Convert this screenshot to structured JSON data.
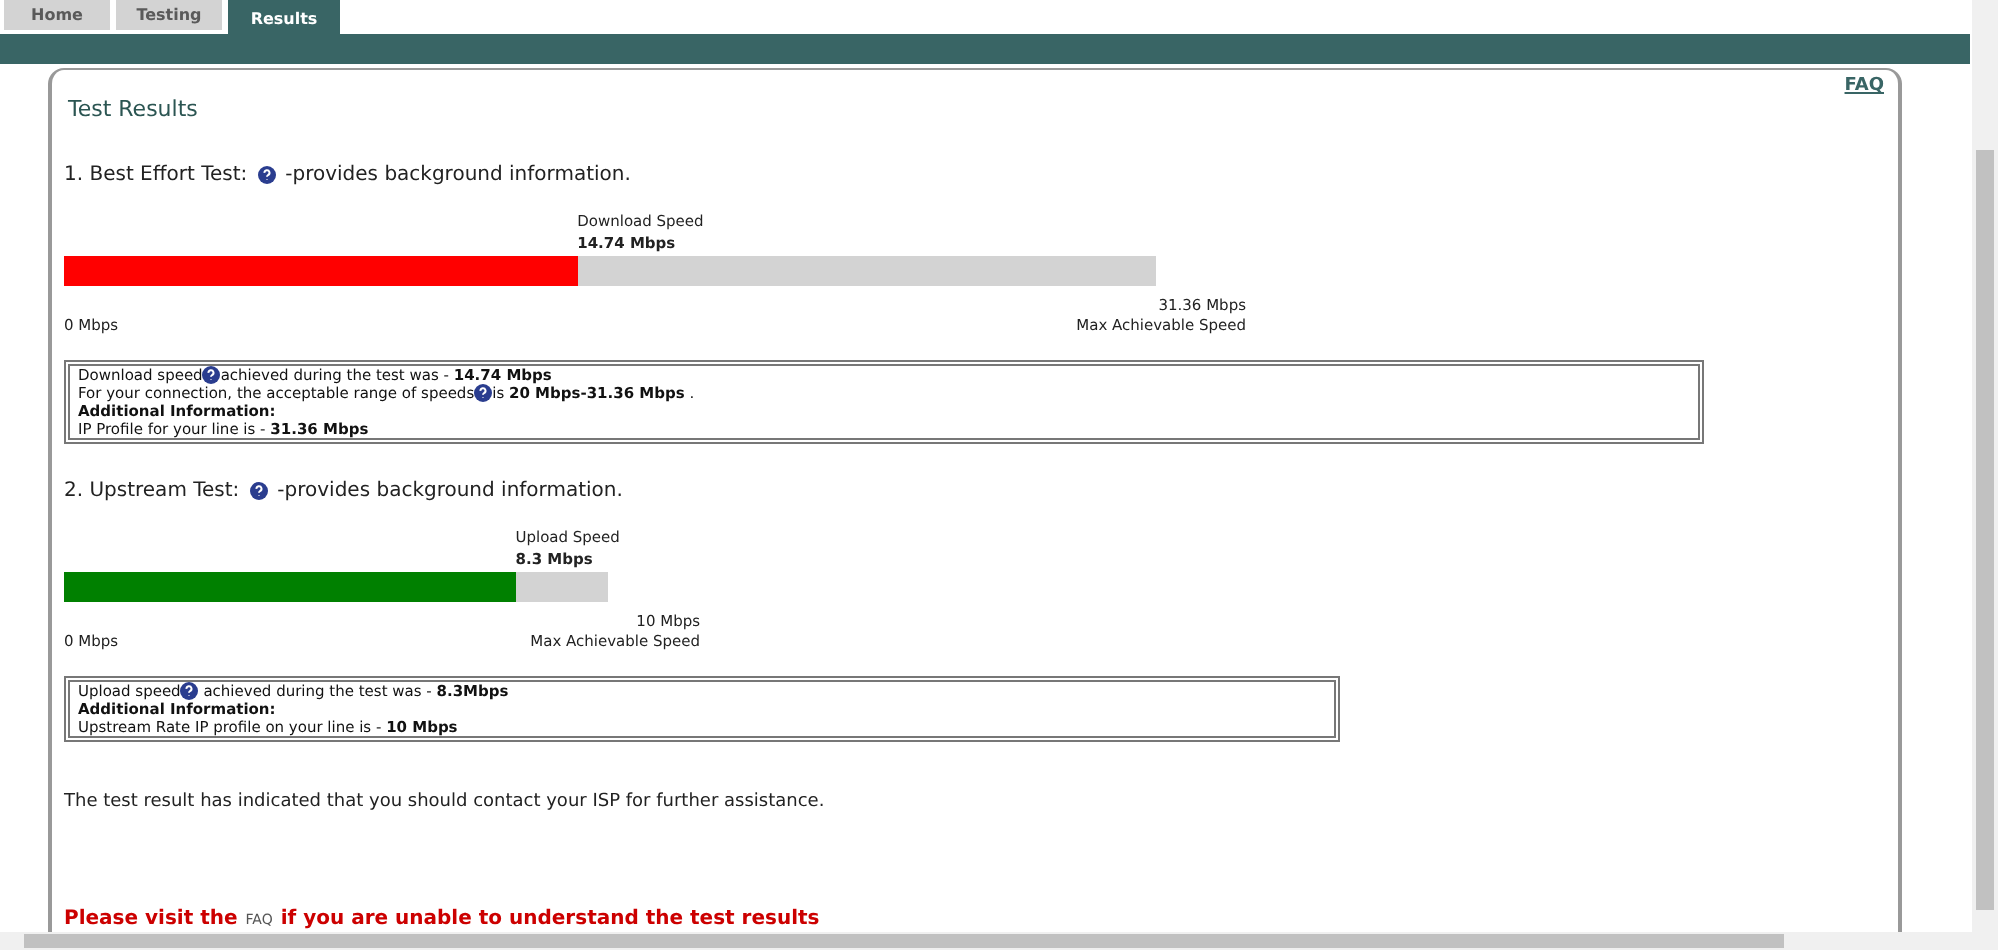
{
  "tabs": [
    {
      "label": "Home",
      "selected": false
    },
    {
      "label": "Testing",
      "selected": false
    },
    {
      "label": "Results",
      "selected": true
    }
  ],
  "faq_link": "FAQ",
  "title": "Test Results",
  "tests": [
    {
      "heading": "1. Best Effort Test:",
      "heading_suffix": "-provides background information.",
      "speed_label": "Download Speed",
      "speed_value": "14.74 Mbps",
      "level": 0.47,
      "color": "#ff0000",
      "min_label": "0 Mbps",
      "max_value": "31.36 Mbps",
      "max_label": "Max Achievable Speed",
      "info_lines": [
        {
          "kind": "help",
          "before": "Download speed",
          "after": "achieved during the test was - **14.74 Mbps**"
        },
        {
          "kind": "help",
          "before": "For your connection, the acceptable range of speeds",
          "after": "is **20 Mbps-31.36 Mbps** ."
        },
        {
          "kind": "heading",
          "before": "Additional Information:"
        },
        {
          "kind": "plain",
          "before": "IP Profile for your line is - **31.36 Mbps**"
        }
      ]
    },
    {
      "heading": "2. Upstream Test:",
      "heading_suffix": "-provides background information.",
      "speed_label": "Upload Speed",
      "speed_value": "8.3 Mbps",
      "level": 0.83,
      "color": "#008000",
      "min_label": "0 Mbps",
      "max_value": "10 Mbps",
      "max_label": "Max Achievable Speed",
      "info_lines": [
        {
          "kind": "help",
          "before": "Upload speed",
          "after": " achieved during the test was - **8.3Mbps**"
        },
        {
          "kind": "heading",
          "before": "Additional Information:"
        },
        {
          "kind": "plain",
          "before": "Upstream Rate IP profile on your line is - **10 Mbps**"
        }
      ]
    }
  ],
  "message": "The test result has indicated that you should contact your ISP for further assistance.",
  "footer_note": {
    "before": "Please visit the",
    "link": "FAQ",
    "after": "if you are unable to understand the test results"
  }
}
